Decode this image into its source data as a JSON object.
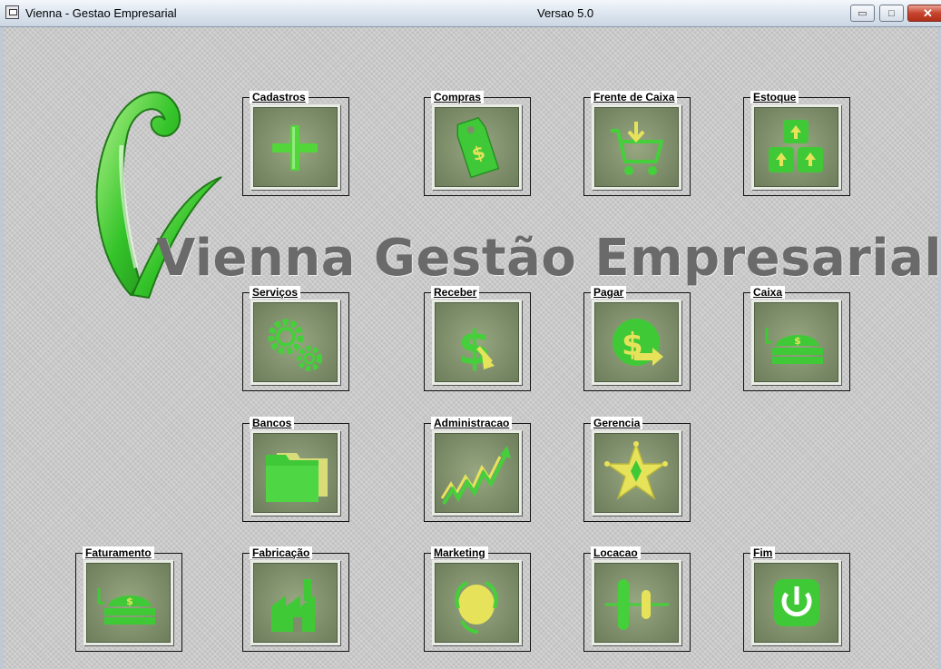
{
  "window": {
    "title": "Vienna - Gestao Empresarial",
    "version": "Versao 5.0",
    "minimize_symbol": "▭",
    "restore_symbol": "□",
    "close_symbol": "✕"
  },
  "brand": {
    "text": "Vienna Gestão Empresarial"
  },
  "tiles": {
    "cadastros": {
      "label": "Cadastros",
      "icon": "plus-icon"
    },
    "compras": {
      "label": "Compras",
      "icon": "price-tag-icon"
    },
    "frente_caixa": {
      "label": "Frente de Caixa",
      "icon": "shopping-cart-icon"
    },
    "estoque": {
      "label": "Estoque",
      "icon": "stock-boxes-icon"
    },
    "servicos": {
      "label": "Serviços",
      "icon": "gears-icon"
    },
    "receber": {
      "label": "Receber",
      "icon": "dollar-in-icon"
    },
    "pagar": {
      "label": "Pagar",
      "icon": "dollar-out-icon"
    },
    "caixa": {
      "label": "Caixa",
      "icon": "cash-register-icon"
    },
    "bancos": {
      "label": "Bancos",
      "icon": "folder-icon"
    },
    "administracao": {
      "label": "Administracao",
      "icon": "growth-chart-icon"
    },
    "gerencia": {
      "label": "Gerencia",
      "icon": "sheriff-star-icon"
    },
    "faturamento": {
      "label": "Faturamento",
      "icon": "cash-register-icon"
    },
    "fabricacao": {
      "label": "Fabricação",
      "icon": "factory-icon"
    },
    "marketing": {
      "label": "Marketing",
      "icon": "headset-icon"
    },
    "locacao": {
      "label": "Locacao",
      "icon": "slider-icon"
    },
    "fim": {
      "label": "Fim",
      "icon": "power-icon"
    }
  },
  "colors": {
    "icon_green": "#3ec43a",
    "icon_green_light": "#8df06e",
    "icon_yellow": "#e6e35a",
    "tile_bg": "#7e8d6a",
    "brand_text": "#6a6a6a"
  }
}
